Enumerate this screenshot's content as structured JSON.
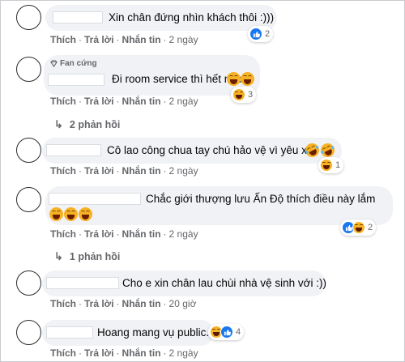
{
  "actions": {
    "like": "Thích",
    "reply": "Trả lời",
    "message": "Nhắn tin",
    "sep": "·"
  },
  "badge": {
    "fan_label": "Fan cứng"
  },
  "colors": {
    "like_blue": "#1877f2",
    "haha_yellow": "#f7b125",
    "bubble_bg": "#f0f2f5",
    "meta_gray": "#65676b"
  },
  "comments": [
    {
      "text": "Xin chân đứng nhìn khách thôi :)))",
      "time": "2 ngày",
      "reactions": [
        "like-icon"
      ],
      "count": "2"
    },
    {
      "text": "Đi room service thì hết nấc",
      "time": "2 ngày",
      "emoji": [
        "haha-emoji",
        "haha-emoji"
      ],
      "reactions": [
        "haha-icon"
      ],
      "count": "3",
      "fan": true
    },
    {
      "text": "Cô lao công chua tay chú hảo vệ vì yêu xa",
      "time": "2 ngày",
      "emoji": [
        "rofl-emoji",
        "rofl-emoji"
      ],
      "reactions": [
        "haha-icon"
      ],
      "count": "1"
    },
    {
      "text": "Chắc giới thượng lưu Ấn Độ thích điều này lắm",
      "time": "2 ngày",
      "emoji": [
        "grinning-emoji",
        "grinning-emoji",
        "grinning-emoji"
      ],
      "reactions": [
        "like-icon",
        "haha-icon"
      ],
      "count": "2"
    },
    {
      "text": "Cho e xin chân lau chùi nhà vệ sinh với :))",
      "time": "20 giờ",
      "reactions": [],
      "count": ""
    },
    {
      "text": "Hoang mang vụ public.",
      "time": "2 ngày",
      "reactions": [
        "haha-icon",
        "like-icon"
      ],
      "count": "4"
    }
  ],
  "reply_links": [
    {
      "label": "2 phản hồi"
    },
    {
      "label": "1 phản hồi"
    }
  ]
}
